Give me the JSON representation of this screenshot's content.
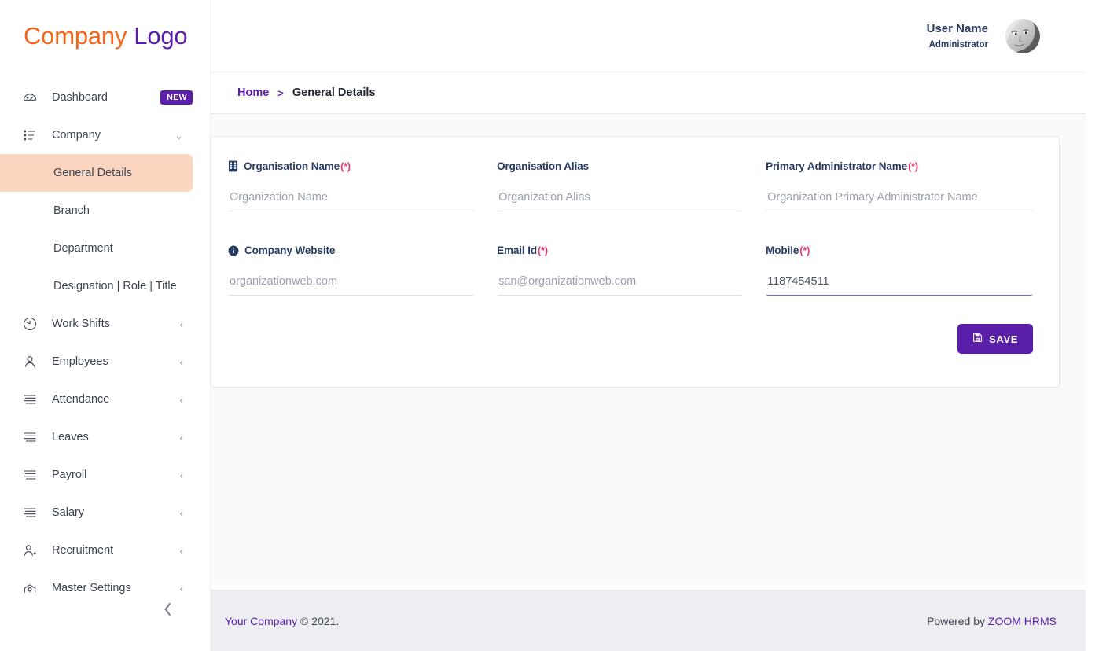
{
  "brand": {
    "logo_part1": "Company",
    "logo_part2": "Logo",
    "color_orange": "#f4651b",
    "color_purple": "#5b1ea8"
  },
  "header": {
    "user_name": "User Name",
    "user_role": "Administrator",
    "avatar_icon": "user-avatar-photo"
  },
  "breadcrumb": {
    "home": "Home",
    "separator": ">",
    "current": "General Details"
  },
  "sidebar": {
    "collapse_icon": "chevron-left-icon",
    "items": [
      {
        "label": "Dashboard",
        "icon": "speedometer-icon",
        "badge": "NEW",
        "chevron": ""
      },
      {
        "label": "Company",
        "icon": "list-ol-icon",
        "badge": "",
        "chevron": "⌄"
      },
      {
        "label": "Work Shifts",
        "icon": "clock-icon",
        "badge": "",
        "chevron": "‹"
      },
      {
        "label": "Employees",
        "icon": "user-icon",
        "badge": "",
        "chevron": "‹"
      },
      {
        "label": "Attendance",
        "icon": "lines-icon",
        "badge": "",
        "chevron": "‹"
      },
      {
        "label": "Leaves",
        "icon": "lines-icon",
        "badge": "",
        "chevron": "‹"
      },
      {
        "label": "Payroll",
        "icon": "lines-icon",
        "badge": "",
        "chevron": "‹"
      },
      {
        "label": "Salary",
        "icon": "lines-icon",
        "badge": "",
        "chevron": "‹"
      },
      {
        "label": "Recruitment",
        "icon": "user-plus-icon",
        "badge": "",
        "chevron": "‹"
      },
      {
        "label": "Master Settings",
        "icon": "gear-home-icon",
        "badge": "",
        "chevron": "‹"
      }
    ],
    "company_submenu": [
      {
        "label": "General Details",
        "active": true
      },
      {
        "label": "Branch",
        "active": false
      },
      {
        "label": "Department",
        "active": false
      },
      {
        "label": "Designation | Role | Title",
        "active": false
      }
    ]
  },
  "form": {
    "required_mark": "(*)",
    "fields": [
      {
        "label": "Organisation Name",
        "required": true,
        "icon": "building-icon",
        "placeholder": "Organization Name",
        "value": "",
        "focused": false
      },
      {
        "label": "Organisation Alias",
        "required": false,
        "icon": "",
        "placeholder": "Organization Alias",
        "value": "",
        "focused": false
      },
      {
        "label": "Primary Administrator Name",
        "required": true,
        "icon": "",
        "placeholder": "Organization Primary Administrator Name",
        "value": "",
        "focused": false
      },
      {
        "label": "Company Website",
        "required": false,
        "icon": "info-circle-icon",
        "placeholder": "organizationweb.com",
        "value": "",
        "focused": false
      },
      {
        "label": "Email Id",
        "required": true,
        "icon": "",
        "placeholder": "san@organizationweb.com",
        "value": "",
        "focused": false
      },
      {
        "label": "Mobile",
        "required": true,
        "icon": "",
        "placeholder": "",
        "value": "1187454511",
        "focused": true
      }
    ],
    "save_label": "SAVE",
    "save_icon": "save-floppy-icon",
    "save_color": "#5b1ea8"
  },
  "footer": {
    "left_brand": "Your Company",
    "left_rest": " © 2021.",
    "right_prefix": "Powered by ",
    "right_brand": "ZOOM HRMS"
  }
}
